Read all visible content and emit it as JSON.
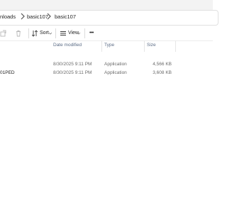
{
  "breadcrumb": {
    "items": [
      "nloads",
      "basic107",
      "basic107"
    ]
  },
  "toolbar": {
    "sort_label": "Sort",
    "view_label": "View",
    "more_label": "•••"
  },
  "columns": {
    "date_modified": "Date modified",
    "type": "Type",
    "size": "Size"
  },
  "files": [
    {
      "name": "",
      "date": "8/30/2025 9:11 PM",
      "type": "Application",
      "size": "4,566 KB"
    },
    {
      "name": "01PED",
      "date": "8/30/2025 9:11 PM",
      "type": "Application",
      "size": "3,608 KB"
    }
  ],
  "colors": {
    "header_text": "#5a6b85",
    "row_text": "#6b6b6b",
    "address_bg": "#f3f3f3"
  },
  "icons": [
    "chevron-right-icon",
    "share-icon",
    "delete-icon",
    "sort-icon",
    "chevron-down-icon",
    "view-icon",
    "more-icon"
  ]
}
